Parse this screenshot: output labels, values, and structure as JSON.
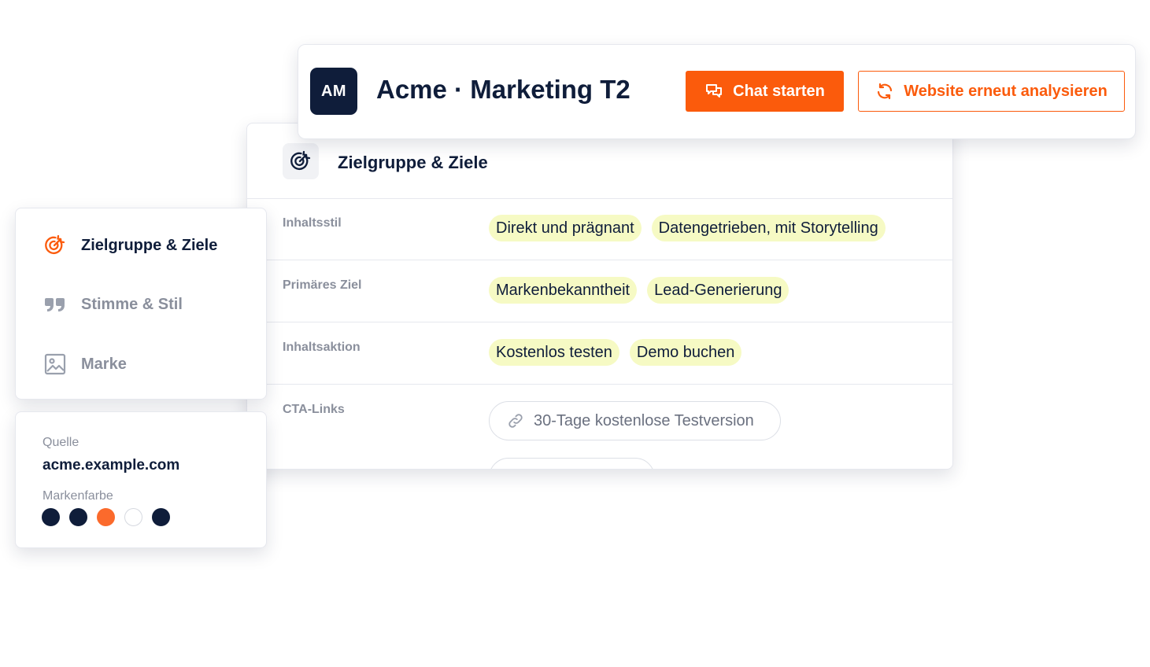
{
  "header": {
    "avatar_initials": "AM",
    "title": "Acme · Marketing T2",
    "chat_button": "Chat starten",
    "reanalyze_button": "Website erneut analysieren"
  },
  "panel": {
    "title": "Zielgruppe & Ziele",
    "rows": [
      {
        "label": "Inhaltsstil",
        "tags": [
          "Direkt und prägnant",
          "Datengetrieben, mit Storytelling"
        ]
      },
      {
        "label": "Primäres Ziel",
        "tags": [
          "Markenbekanntheit",
          "Lead-Generierung"
        ]
      },
      {
        "label": "Inhaltsaktion",
        "tags": [
          "Kostenlos testen",
          "Demo buchen"
        ]
      },
      {
        "label": "CTA-Links",
        "link": "30-Tage kostenlose Testversion"
      }
    ]
  },
  "nav": {
    "items": [
      {
        "label": "Zielgruppe & Ziele",
        "icon": "target-icon",
        "active": true
      },
      {
        "label": "Stimme & Stil",
        "icon": "quote-icon",
        "active": false
      },
      {
        "label": "Marke",
        "icon": "image-icon",
        "active": false
      }
    ]
  },
  "source": {
    "source_label": "Quelle",
    "source_value": "acme.example.com",
    "color_label": "Markenfarbe",
    "colors": [
      "#0f1d3a",
      "#0f1d3a",
      "#fb6a2c",
      "#ffffff",
      "#0f1d3a"
    ]
  },
  "theme": {
    "accent": "#fb5b0c",
    "navy": "#0f1d3a",
    "tag_bg": "#f6fac4",
    "muted": "#8a8f9c"
  }
}
